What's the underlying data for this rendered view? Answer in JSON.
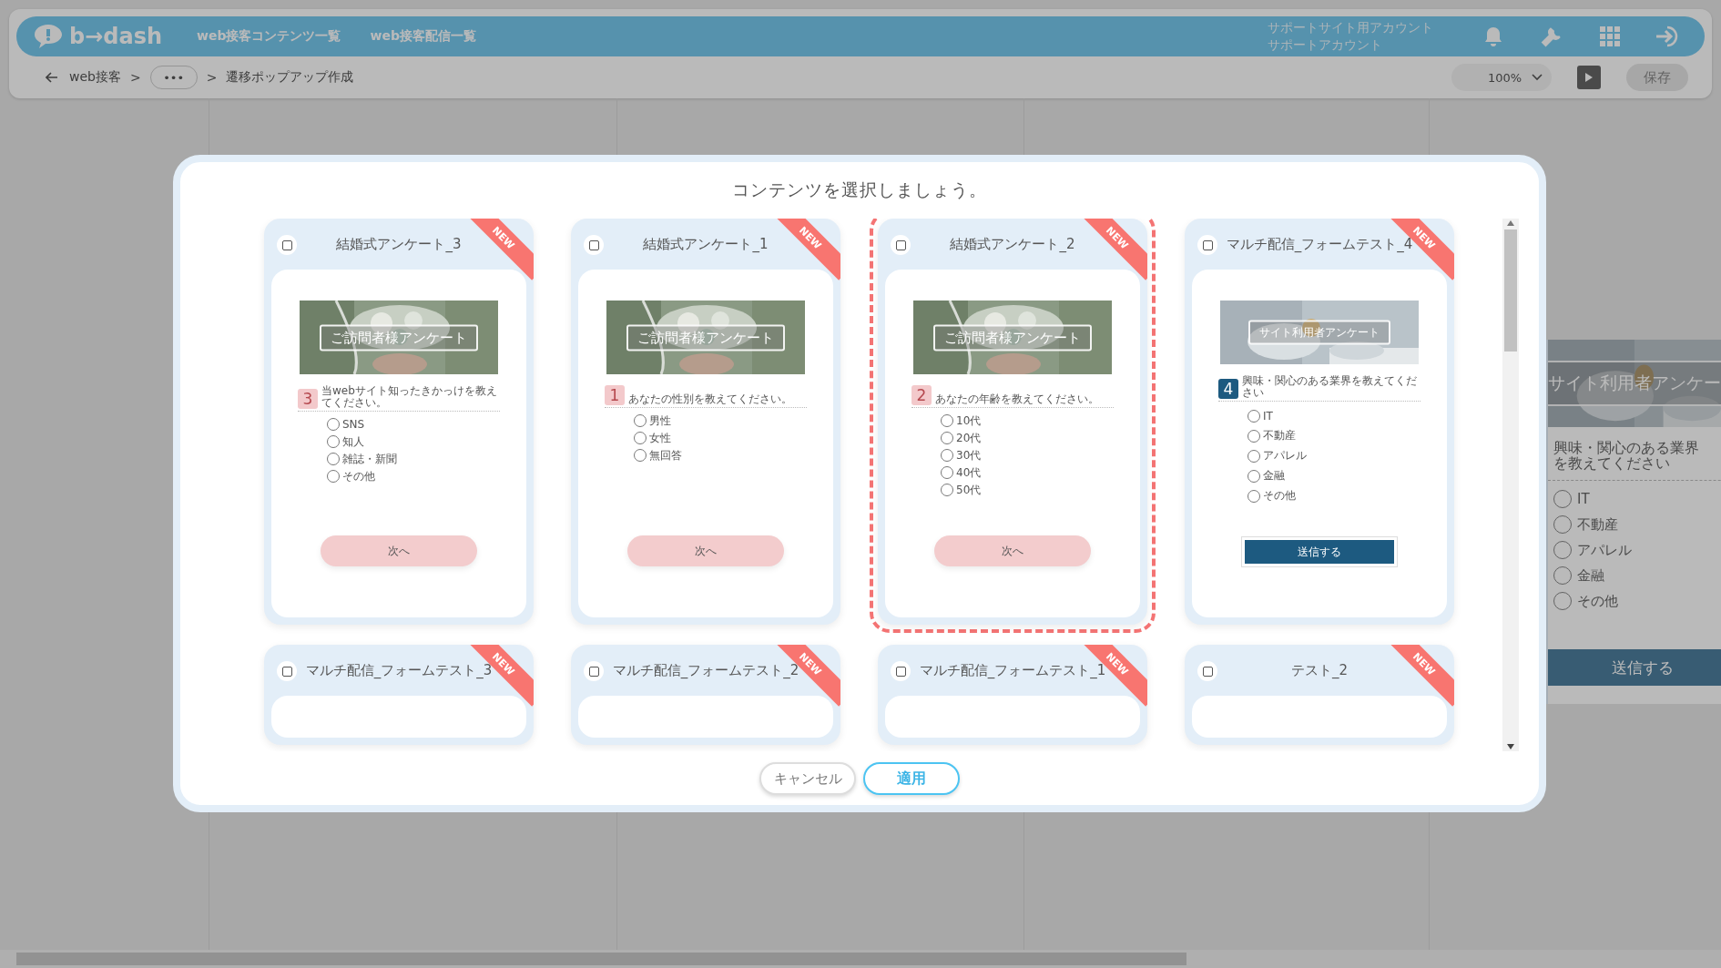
{
  "header": {
    "logo": "b→dash",
    "nav": [
      "web接客コンテンツ一覧",
      "web接客配信一覧"
    ],
    "account": [
      "サポートサイト用アカウント",
      "サポートアカウント"
    ]
  },
  "breadcrumb": {
    "items": [
      "web接客",
      ">",
      "•••",
      ">",
      "遷移ポップアップ作成"
    ]
  },
  "toolbar": {
    "zoom": "100%",
    "save": {
      "label": "保存",
      "disabled": true
    }
  },
  "preview": {
    "banner": "サイト利用者アンケー",
    "question": "興味・関心のある業界を教えてください",
    "options": [
      {
        "label": "IT",
        "selected": false
      },
      {
        "label": "不動産",
        "selected": false
      },
      {
        "label": "アパレル",
        "selected": false
      },
      {
        "label": "金融",
        "selected": false
      },
      {
        "label": "その他",
        "selected": false
      }
    ],
    "button": "送信する"
  },
  "modal": {
    "title": "コンテンツを選択しましょう。",
    "cards": [
      {
        "title": "結婚式アンケート_3",
        "checked": false,
        "selected": false,
        "new": true,
        "new_label": "NEW",
        "preview": {
          "kind": "wedding",
          "banner": "ご訪問者様アンケート",
          "number": "3",
          "question": "当webサイト知ったきかっけを教えてください。",
          "options": [
            {
              "label": "SNS",
              "selected": false
            },
            {
              "label": "知人",
              "selected": false
            },
            {
              "label": "雑誌・新聞",
              "selected": false
            },
            {
              "label": "その他",
              "selected": false
            }
          ],
          "button": {
            "label": "次へ",
            "kind": "pill"
          }
        }
      },
      {
        "title": "結婚式アンケート_1",
        "checked": false,
        "selected": false,
        "new": true,
        "new_label": "NEW",
        "preview": {
          "kind": "wedding",
          "banner": "ご訪問者様アンケート",
          "number": "1",
          "question": "あなたの性別を教えてください。",
          "options": [
            {
              "label": "男性",
              "selected": false
            },
            {
              "label": "女性",
              "selected": false
            },
            {
              "label": "無回答",
              "selected": false
            }
          ],
          "button": {
            "label": "次へ",
            "kind": "pill"
          }
        }
      },
      {
        "title": "結婚式アンケート_2",
        "checked": false,
        "selected": true,
        "new": true,
        "new_label": "NEW",
        "preview": {
          "kind": "wedding",
          "banner": "ご訪問者様アンケート",
          "number": "2",
          "question": "あなたの年齢を教えてください。",
          "options": [
            {
              "label": "10代",
              "selected": false
            },
            {
              "label": "20代",
              "selected": false
            },
            {
              "label": "30代",
              "selected": false
            },
            {
              "label": "40代",
              "selected": false
            },
            {
              "label": "50代",
              "selected": false
            }
          ],
          "button": {
            "label": "次へ",
            "kind": "pill"
          }
        }
      },
      {
        "title": "マルチ配信_フォームテスト_4",
        "checked": false,
        "selected": false,
        "new": true,
        "new_label": "NEW",
        "preview": {
          "kind": "business",
          "banner": "サイト利用者アンケート",
          "number": "4",
          "question": "興味・関心のある業界を教えてください",
          "options": [
            {
              "label": "IT",
              "selected": false
            },
            {
              "label": "不動産",
              "selected": false
            },
            {
              "label": "アパレル",
              "selected": false
            },
            {
              "label": "金融",
              "selected": false
            },
            {
              "label": "その他",
              "selected": false
            }
          ],
          "button": {
            "label": "送信する",
            "kind": "solid"
          }
        }
      },
      {
        "title": "マルチ配信_フォームテスト_3",
        "checked": false,
        "selected": false,
        "new": true,
        "new_label": "NEW"
      },
      {
        "title": "マルチ配信_フォームテスト_2",
        "checked": false,
        "selected": false,
        "new": true,
        "new_label": "NEW"
      },
      {
        "title": "マルチ配信_フォームテスト_1",
        "checked": false,
        "selected": false,
        "new": true,
        "new_label": "NEW"
      },
      {
        "title": "テスト_2",
        "checked": false,
        "selected": false,
        "new": true,
        "new_label": "NEW"
      }
    ],
    "buttons": {
      "cancel": "キャンセル",
      "apply": "適用"
    }
  }
}
